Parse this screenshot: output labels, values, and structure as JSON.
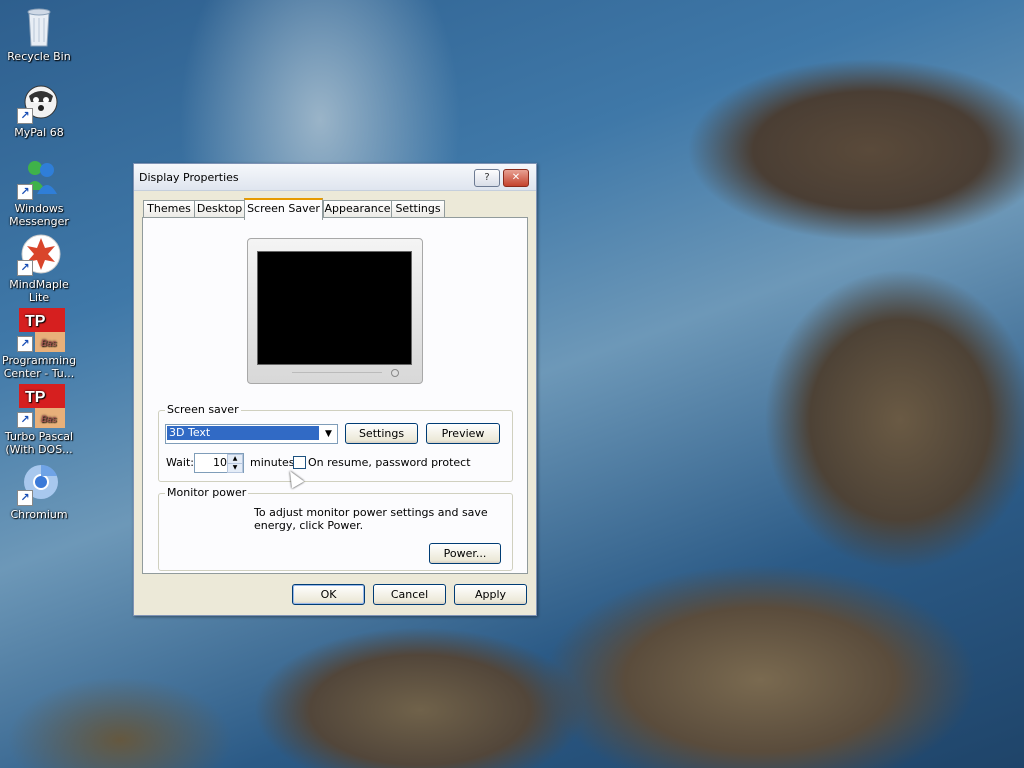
{
  "desktop": {
    "icons": [
      {
        "label": "Recycle Bin",
        "icon": "recycle-bin-icon"
      },
      {
        "label": "MyPal 68",
        "icon": "mypal-icon"
      },
      {
        "label": "Windows Messenger",
        "icon": "messenger-icon"
      },
      {
        "label": "MindMaple Lite",
        "icon": "mindmaple-icon"
      },
      {
        "label": "Programming Center - Tu...",
        "icon": "tp-icon"
      },
      {
        "label": "Turbo Pascal (With DOS...",
        "icon": "tp-icon"
      },
      {
        "label": "Chromium",
        "icon": "chromium-icon"
      }
    ]
  },
  "window": {
    "title": "Display Properties",
    "help_glyph": "?",
    "close_glyph": "✕",
    "tabs": [
      {
        "label": "Themes"
      },
      {
        "label": "Desktop"
      },
      {
        "label": "Screen Saver",
        "active": true
      },
      {
        "label": "Appearance"
      },
      {
        "label": "Settings"
      }
    ],
    "screen_saver": {
      "group_label": "Screen saver",
      "selected": "3D Text",
      "settings_button": "Settings",
      "preview_button": "Preview",
      "wait_label": "Wait:",
      "wait_value": "10",
      "minutes_label": "minutes",
      "password_checkbox_label": "On resume, password protect",
      "password_checked": false
    },
    "monitor_power": {
      "group_label": "Monitor power",
      "description": "To adjust monitor power settings and save energy, click Power.",
      "power_button": "Power..."
    },
    "buttons": {
      "ok": "OK",
      "cancel": "Cancel",
      "apply": "Apply"
    }
  },
  "colors": {
    "selection": "#316ac5",
    "active_tab_accent": "#e69a00",
    "dialog_bg": "#ece9d8"
  }
}
